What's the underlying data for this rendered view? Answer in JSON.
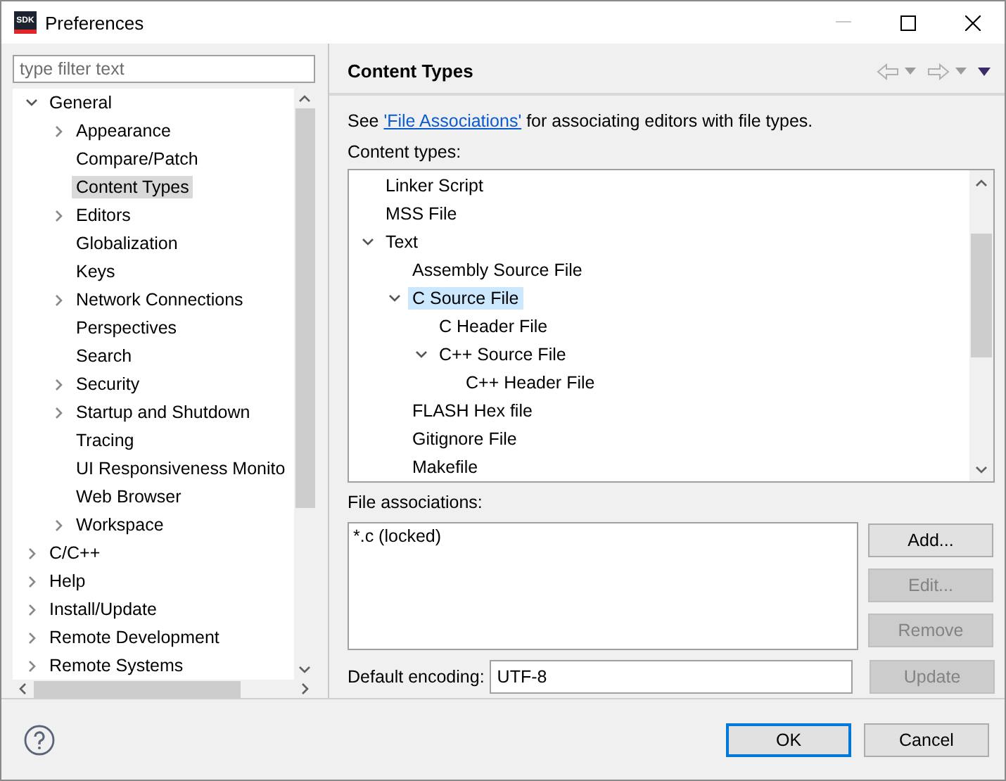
{
  "window": {
    "title": "Preferences",
    "logo_text": "SDK"
  },
  "filter": {
    "placeholder": "type filter text"
  },
  "nav_tree": [
    {
      "label": "General",
      "expanded": true,
      "selected": false,
      "children": [
        {
          "label": "Appearance",
          "expanded": false,
          "selected": false
        },
        {
          "label": "Compare/Patch",
          "selected": false
        },
        {
          "label": "Content Types",
          "selected": true
        },
        {
          "label": "Editors",
          "expanded": false,
          "selected": false
        },
        {
          "label": "Globalization",
          "selected": false
        },
        {
          "label": "Keys",
          "selected": false
        },
        {
          "label": "Network Connections",
          "expanded": false,
          "selected": false
        },
        {
          "label": "Perspectives",
          "selected": false
        },
        {
          "label": "Search",
          "selected": false
        },
        {
          "label": "Security",
          "expanded": false,
          "selected": false
        },
        {
          "label": "Startup and Shutdown",
          "expanded": false,
          "selected": false
        },
        {
          "label": "Tracing",
          "selected": false
        },
        {
          "label": "UI Responsiveness Monito",
          "selected": false
        },
        {
          "label": "Web Browser",
          "selected": false
        },
        {
          "label": "Workspace",
          "expanded": false,
          "selected": false
        }
      ]
    },
    {
      "label": "C/C++",
      "expanded": false,
      "selected": false
    },
    {
      "label": "Help",
      "expanded": false,
      "selected": false
    },
    {
      "label": "Install/Update",
      "expanded": false,
      "selected": false
    },
    {
      "label": "Remote Development",
      "expanded": false,
      "selected": false
    },
    {
      "label": "Remote Systems",
      "expanded": false,
      "selected": false
    }
  ],
  "page": {
    "title": "Content Types",
    "intro_before": "See ",
    "intro_link": "'File Associations'",
    "intro_after": " for associating editors with file types.",
    "content_types_label": "Content types:",
    "content_types": [
      {
        "label": "Linker Script",
        "selected": false
      },
      {
        "label": "MSS File",
        "selected": false
      },
      {
        "label": "Text",
        "expanded": true,
        "selected": false,
        "children": [
          {
            "label": "Assembly Source File",
            "selected": false
          },
          {
            "label": "C Source File",
            "expanded": true,
            "selected": true,
            "children": [
              {
                "label": "C Header File",
                "selected": false
              },
              {
                "label": "C++ Source File",
                "expanded": true,
                "selected": false,
                "children": [
                  {
                    "label": "C++ Header File",
                    "selected": false
                  }
                ]
              }
            ]
          },
          {
            "label": "FLASH Hex file",
            "selected": false
          },
          {
            "label": "Gitignore File",
            "selected": false
          },
          {
            "label": "Makefile",
            "selected": false
          }
        ]
      }
    ],
    "file_associations_label": "File associations:",
    "file_associations": [
      "*.c (locked)"
    ],
    "side_buttons": [
      {
        "label": "Add...",
        "disabled": false
      },
      {
        "label": "Edit...",
        "disabled": true
      },
      {
        "label": "Remove",
        "disabled": true
      },
      {
        "label": "Update",
        "disabled": true
      }
    ],
    "encoding_label": "Default encoding:",
    "encoding_value": "UTF-8"
  },
  "footer_buttons": [
    {
      "label": "OK",
      "default": true
    },
    {
      "label": "Cancel",
      "default": false
    }
  ]
}
